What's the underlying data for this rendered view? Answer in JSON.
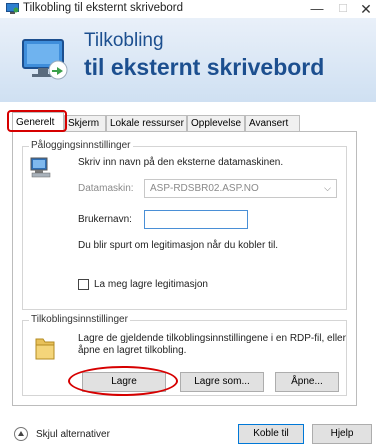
{
  "window": {
    "title": "Tilkobling til eksternt skrivebord",
    "minimize_glyph": "—",
    "maximize_glyph": "☐",
    "close_glyph": "✕"
  },
  "banner": {
    "line1": "Tilkobling",
    "line2": "til eksternt skrivebord"
  },
  "tabs": [
    {
      "label": "Generelt",
      "active": true
    },
    {
      "label": "Skjerm"
    },
    {
      "label": "Lokale ressurser"
    },
    {
      "label": "Opplevelse"
    },
    {
      "label": "Avansert"
    }
  ],
  "login_group": {
    "legend": "Påloggingsinnstillinger",
    "instruction": "Skriv inn navn på den eksterne datamaskinen.",
    "computer_label": "Datamaskin:",
    "computer_value": "ASP-RDSBR02.ASP.NO",
    "username_label": "Brukernavn:",
    "username_value": "",
    "credentials_note": "Du blir spurt om legitimasjon når du kobler til.",
    "save_credentials_label": "La meg lagre legitimasjon",
    "save_credentials_checked": false
  },
  "connection_group": {
    "legend": "Tilkoblingsinnstillinger",
    "description_line1": "Lagre de gjeldende tilkoblingsinnstillingene i en RDP-fil, eller",
    "description_line2": "åpne en lagret tilkobling.",
    "save_label": "Lagre",
    "save_as_label": "Lagre som...",
    "open_label": "Åpne..."
  },
  "footer": {
    "hide_options_label": "Skjul alternativer",
    "connect_label": "Koble til",
    "help_label": "Hjelp"
  },
  "colors": {
    "highlight_red": "#d60000",
    "banner_text": "#1c4f8f",
    "focus_blue": "#4a8fd6"
  },
  "icons": [
    "remote-desktop-app-icon",
    "remote-desktop-monitor-icon",
    "computer-icon",
    "folder-icon",
    "collapse-arrow-icon"
  ]
}
